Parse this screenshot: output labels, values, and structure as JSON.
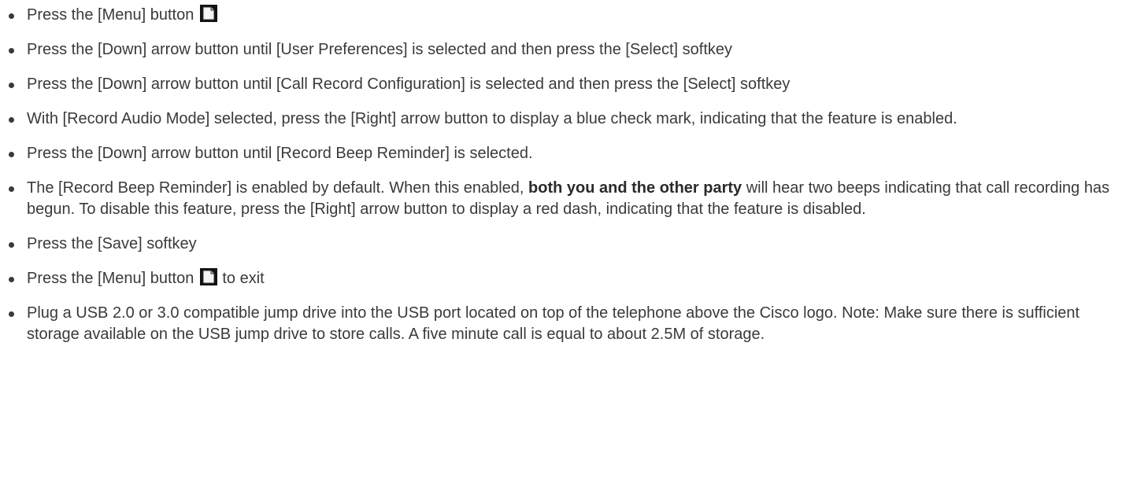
{
  "steps": [
    {
      "pre": "Press the [Menu] button",
      "icon": "menu-button-icon"
    },
    {
      "text": "Press the [Down] arrow button until [User Preferences] is selected and then press the [Select] softkey"
    },
    {
      "text": "Press the [Down] arrow button until [Call Record Configuration] is selected and then press the [Select] softkey"
    },
    {
      "text": "With [Record Audio Mode] selected, press the [Right] arrow button to display a blue check mark, indicating that the feature is enabled."
    },
    {
      "text": "Press the [Down] arrow button until [Record Beep Reminder] is selected."
    },
    {
      "pre": "The [Record Beep Reminder] is enabled by default. When this enabled, ",
      "bold": "both you and the other party",
      "post": " will hear two beeps indicating that call recording has begun. To disable this feature, press the [Right] arrow button to display a red dash, indicating that the feature is disabled."
    },
    {
      "text": "Press the [Save] softkey"
    },
    {
      "pre": "Press the [Menu] button",
      "icon": "menu-button-icon",
      "post": "to exit"
    },
    {
      "text": "Plug a USB 2.0 or 3.0 compatible jump drive into the USB port located on top of the telephone above the Cisco logo. Note: Make sure there is sufficient storage available on the USB jump drive to store calls. A five minute call is equal to about 2.5M of storage."
    }
  ]
}
